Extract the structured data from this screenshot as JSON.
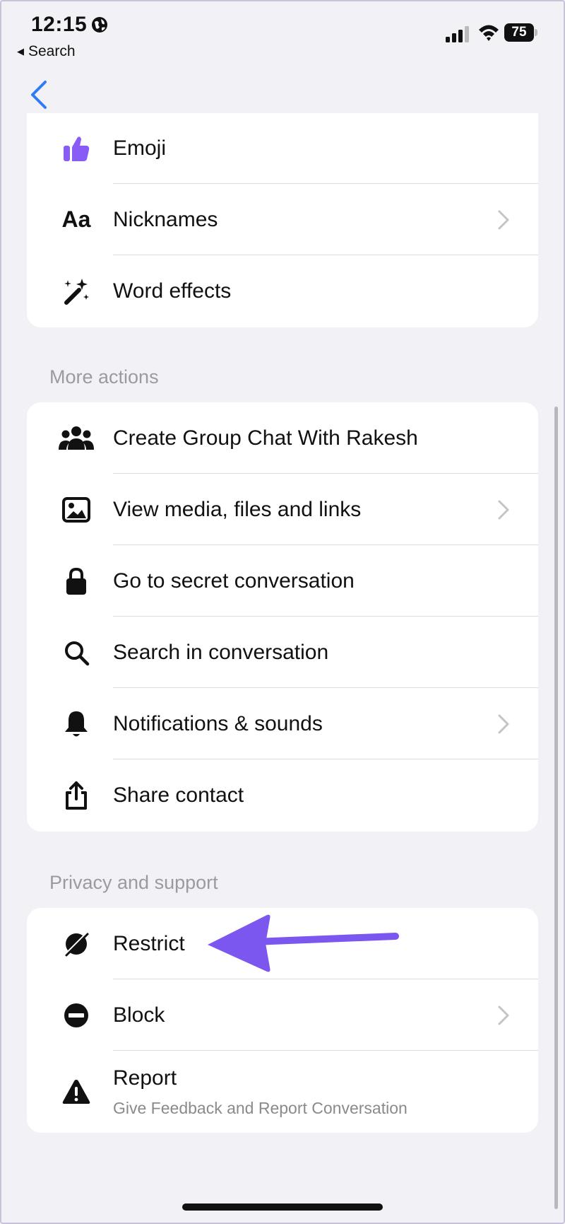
{
  "status_bar": {
    "time": "12:15",
    "back_app": "Search",
    "battery": "75"
  },
  "sections": {
    "top": {
      "items": [
        {
          "label": "Emoji",
          "icon": "thumbs-up-icon",
          "has_chevron": false
        },
        {
          "label": "Nicknames",
          "icon": "text-aa-icon",
          "has_chevron": true
        },
        {
          "label": "Word effects",
          "icon": "magic-wand-icon",
          "has_chevron": false
        }
      ]
    },
    "more_actions": {
      "header": "More actions",
      "items": [
        {
          "label": "Create Group Chat With Rakesh",
          "icon": "group-icon",
          "has_chevron": false
        },
        {
          "label": "View media, files and links",
          "icon": "image-icon",
          "has_chevron": true
        },
        {
          "label": "Go to secret conversation",
          "icon": "lock-icon",
          "has_chevron": false
        },
        {
          "label": "Search in conversation",
          "icon": "search-icon",
          "has_chevron": false
        },
        {
          "label": "Notifications & sounds",
          "icon": "bell-icon",
          "has_chevron": true
        },
        {
          "label": "Share contact",
          "icon": "share-icon",
          "has_chevron": false
        }
      ]
    },
    "privacy_support": {
      "header": "Privacy and support",
      "items": [
        {
          "label": "Restrict",
          "icon": "restrict-icon",
          "has_chevron": false
        },
        {
          "label": "Block",
          "icon": "block-icon",
          "has_chevron": true
        },
        {
          "label": "Report",
          "sublabel": "Give Feedback and Report Conversation",
          "icon": "warning-icon",
          "has_chevron": false
        }
      ]
    }
  },
  "colors": {
    "background": "#f2f2f6",
    "card": "#ffffff",
    "accent_purple": "#8a5cf6",
    "back_chevron_blue": "#2f7cf6",
    "annotation_arrow": "#7b57f0"
  }
}
